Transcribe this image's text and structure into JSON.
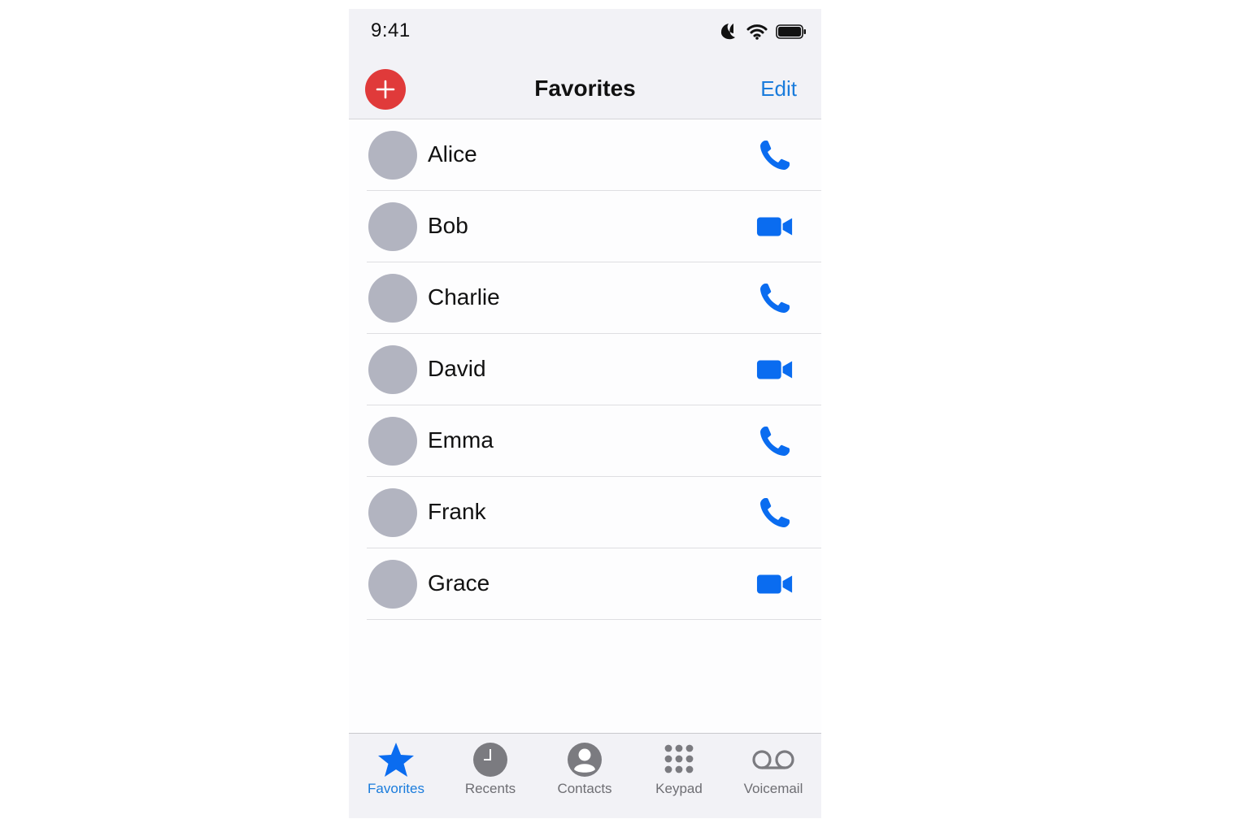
{
  "status_bar": {
    "time": "9:41",
    "icons": [
      "moon-icon",
      "wifi-icon",
      "battery-icon"
    ]
  },
  "navbar": {
    "title": "Favorites",
    "edit_label": "Edit",
    "add_icon": "plus-icon"
  },
  "favorites": [
    {
      "name": "Alice",
      "action": "phone"
    },
    {
      "name": "Bob",
      "action": "video"
    },
    {
      "name": "Charlie",
      "action": "phone"
    },
    {
      "name": "David",
      "action": "video"
    },
    {
      "name": "Emma",
      "action": "phone"
    },
    {
      "name": "Frank",
      "action": "phone"
    },
    {
      "name": "Grace",
      "action": "video"
    }
  ],
  "tabbar": {
    "tabs": [
      {
        "label": "Favorites",
        "icon": "star-icon",
        "active": true
      },
      {
        "label": "Recents",
        "icon": "clock-icon",
        "active": false
      },
      {
        "label": "Contacts",
        "icon": "person-icon",
        "active": false
      },
      {
        "label": "Keypad",
        "icon": "keypad-icon",
        "active": false
      },
      {
        "label": "Voicemail",
        "icon": "voicemail-icon",
        "active": false
      }
    ]
  },
  "colors": {
    "accent": "#1a7cdc",
    "add_button": "#e03a3a",
    "avatar": "#b2b4c0",
    "action_icon": "#0a6cf0"
  }
}
